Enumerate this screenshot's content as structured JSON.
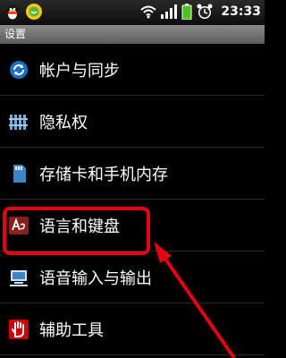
{
  "status_bar": {
    "time": "23:33",
    "icons": [
      "qq-penguin-icon",
      "weather-face-icon",
      "wifi-icon",
      "signal-icon",
      "battery-icon",
      "alarm-clock-icon"
    ]
  },
  "title": "设置",
  "settings_items": [
    {
      "label": "帐户与同步",
      "icon": "sync-icon"
    },
    {
      "label": "隐私权",
      "icon": "privacy-fence-icon"
    },
    {
      "label": "存储卡和手机内存",
      "icon": "sd-card-icon"
    },
    {
      "label": "语言和键盘",
      "icon": "language-keyboard-icon"
    },
    {
      "label": "语音输入与输出",
      "icon": "voice-io-icon"
    },
    {
      "label": "辅助工具",
      "icon": "accessibility-hand-icon"
    }
  ],
  "colors": {
    "highlight": "#e60012",
    "arrow": "#e60012",
    "title_bar": "#707070"
  }
}
